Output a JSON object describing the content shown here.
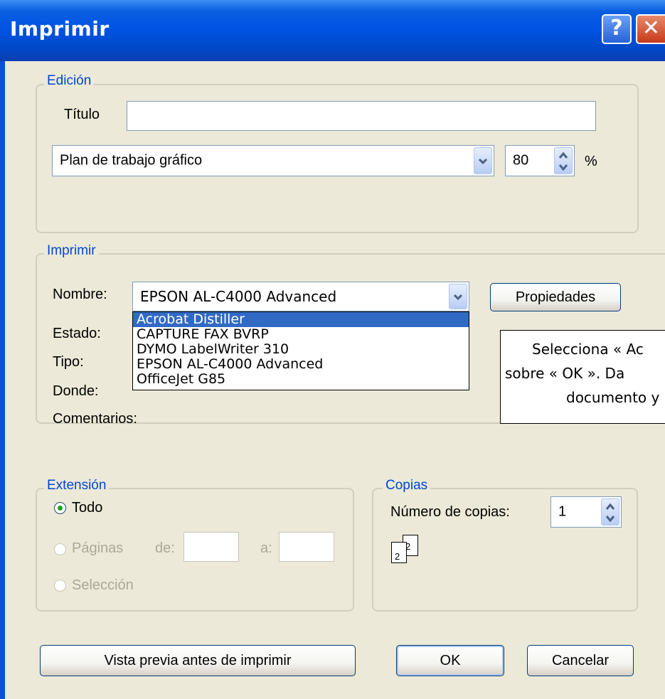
{
  "window": {
    "title": "Imprimir",
    "help": "?",
    "close": "✕"
  },
  "edicion": {
    "legend": "Edición",
    "titulo_label": "Título",
    "titulo_value": "",
    "layout_value": "Plan de trabajo gráfico",
    "zoom_value": "80",
    "zoom_unit": "%"
  },
  "imprimir": {
    "legend": "Imprimir",
    "nombre_label": "Nombre:",
    "printer_value": "EPSON AL-C4000 Advanced",
    "properties_button": "Propiedades",
    "estado_label": "Estado:",
    "tipo_label": "Tipo:",
    "donde_label": "Donde:",
    "comentarios_label": "Comentarios:",
    "printer_options": [
      "Acrobat Distiller",
      "CAPTURE FAX BVRP",
      "DYMO LabelWriter 310",
      "EPSON AL-C4000 Advanced",
      "OfficeJet G85"
    ]
  },
  "note": {
    "line1": "Selecciona « Ac",
    "line2": "sobre « OK ». Da",
    "line3": "documento y"
  },
  "extension": {
    "legend": "Extensión",
    "todo_label": "Todo",
    "paginas_label": "Páginas",
    "de_label": "de:",
    "a_label": "a:",
    "seleccion_label": "Selección"
  },
  "copias": {
    "legend": "Copias",
    "numero_label": "Número de copias:",
    "numero_value": "1",
    "page_back": "2",
    "page_front": "2"
  },
  "buttons": {
    "preview": "Vista previa antes de imprimir",
    "ok": "OK",
    "cancel": "Cancelar"
  }
}
